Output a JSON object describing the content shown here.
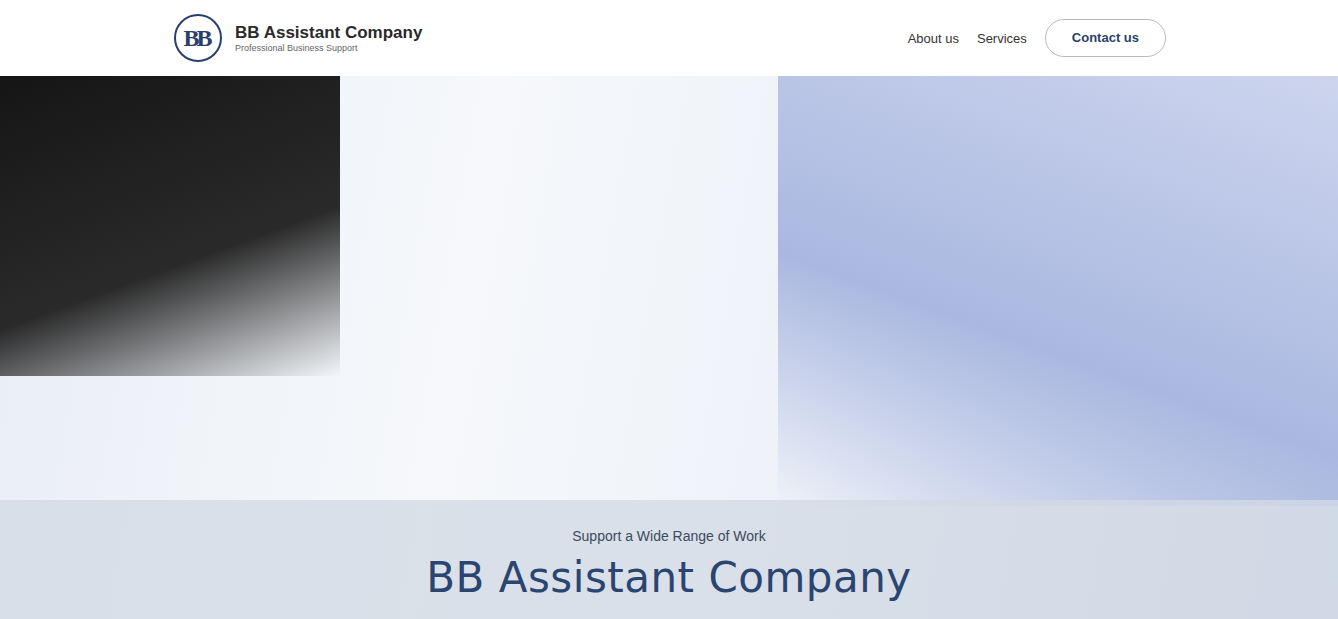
{
  "header": {
    "logo": {
      "letters": "BB"
    },
    "title": "BB Assistant Company",
    "subtitle": "Professional Business Support"
  },
  "nav": {
    "items": [
      {
        "label": "About us"
      },
      {
        "label": "Services"
      }
    ],
    "button": "Contact us"
  },
  "hero": {
    "kicker": "Support a Wide Range of Work",
    "title": "BB Assistant Company"
  }
}
